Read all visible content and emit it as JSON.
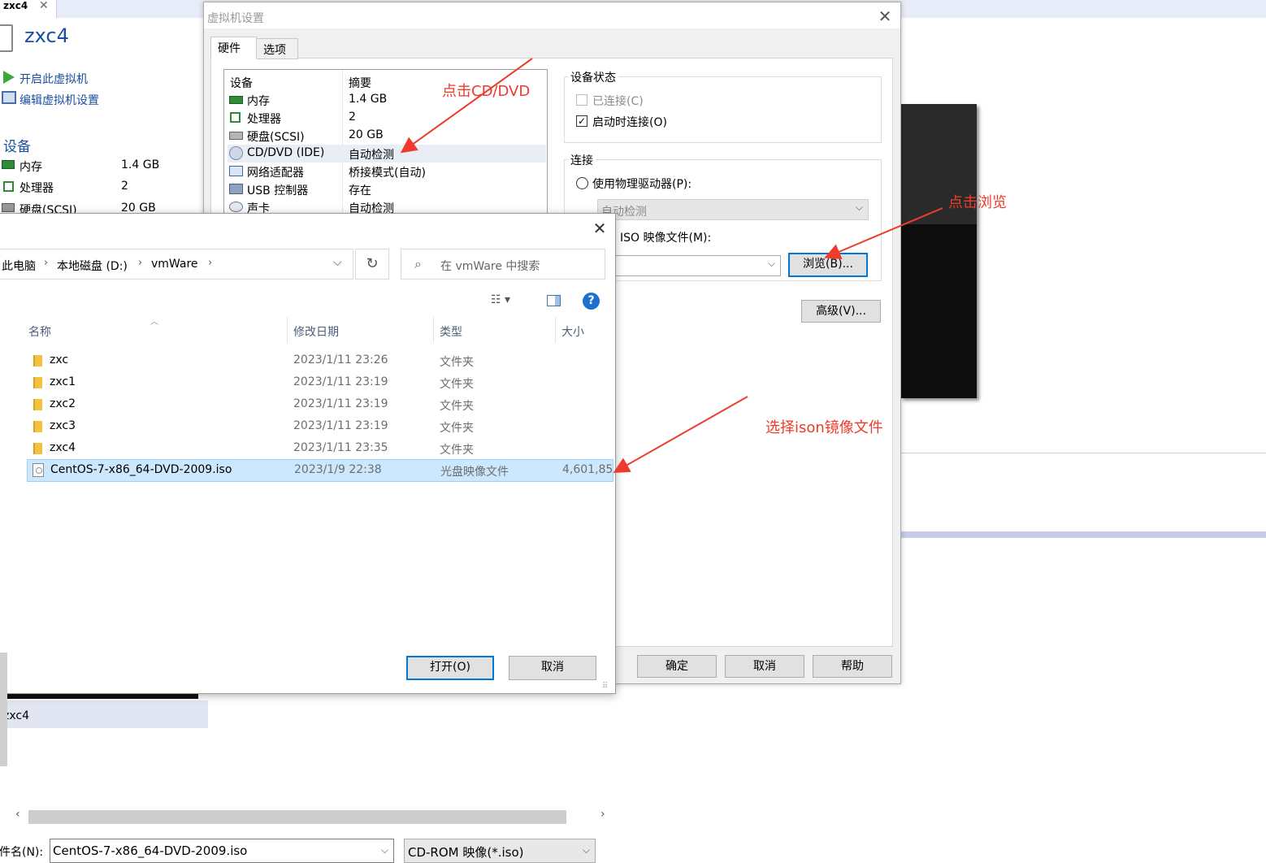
{
  "background": {
    "tab_label": "zxc4",
    "tab_close": "✕",
    "vm_name": "zxc4",
    "actions": [
      {
        "label": "开启此虚拟机"
      },
      {
        "label": "编辑虚拟机设置"
      }
    ],
    "devices_title": "设备",
    "devices": [
      {
        "name": "内存",
        "value": "1.4 GB"
      },
      {
        "name": "处理器",
        "value": "2"
      },
      {
        "name": "硬盘(SCSI)",
        "value": "20 GB"
      }
    ],
    "thumbnail_label": "zxc4"
  },
  "vm_settings": {
    "title": "虚拟机设置",
    "close": "✕",
    "tabs": [
      {
        "label": "硬件",
        "active": true
      },
      {
        "label": "选项",
        "active": false
      }
    ],
    "device_list": {
      "headers": [
        "设备",
        "摘要"
      ],
      "rows": [
        {
          "device": "内存",
          "summary": "1.4 GB",
          "icon": "memory-icon"
        },
        {
          "device": "处理器",
          "summary": "2",
          "icon": "cpu-icon"
        },
        {
          "device": "硬盘(SCSI)",
          "summary": "20 GB",
          "icon": "harddisk-icon"
        },
        {
          "device": "CD/DVD (IDE)",
          "summary": "自动检测",
          "icon": "cdrom-icon",
          "selected": true
        },
        {
          "device": "网络适配器",
          "summary": "桥接模式(自动)",
          "icon": "network-icon"
        },
        {
          "device": "USB 控制器",
          "summary": "存在",
          "icon": "usb-icon"
        },
        {
          "device": "声卡",
          "summary": "自动检测",
          "icon": "sound-icon"
        }
      ]
    },
    "device_status": {
      "title": "设备状态",
      "connected_label": "已连接(C)",
      "connected": false,
      "connect_at_power_on_label": "启动时连接(O)",
      "connect_at_power_on": true
    },
    "connection": {
      "title": "连接",
      "physical_drive_label": "使用物理驱动器(P):",
      "physical_drive_value": "自动检测",
      "iso_label": "ISO 映像文件(M):",
      "iso_value": "",
      "browse_button": "浏览(B)..."
    },
    "advanced_button": "高级(V)...",
    "footer_buttons": {
      "ok": "确定",
      "cancel": "取消",
      "help": "帮助"
    }
  },
  "file_dialog": {
    "close": "✕",
    "breadcrumb": [
      "此电脑",
      "本地磁盘 (D:)",
      "vmWare"
    ],
    "breadcrumb_sep": "›",
    "dropdown": "⌵",
    "refresh": "↻",
    "search_placeholder": "在 vmWare 中搜索",
    "search_icon": "⌕",
    "help": "?",
    "view_menu": "☷ ▾",
    "columns": {
      "name": "名称",
      "modified": "修改日期",
      "type": "类型",
      "size": "大小"
    },
    "files": [
      {
        "name": "zxc",
        "modified": "2023/1/11 23:26",
        "type": "文件夹",
        "size": "",
        "kind": "folder"
      },
      {
        "name": "zxc1",
        "modified": "2023/1/11 23:19",
        "type": "文件夹",
        "size": "",
        "kind": "folder"
      },
      {
        "name": "zxc2",
        "modified": "2023/1/11 23:19",
        "type": "文件夹",
        "size": "",
        "kind": "folder"
      },
      {
        "name": "zxc3",
        "modified": "2023/1/11 23:19",
        "type": "文件夹",
        "size": "",
        "kind": "folder"
      },
      {
        "name": "zxc4",
        "modified": "2023/1/11 23:35",
        "type": "文件夹",
        "size": "",
        "kind": "folder"
      },
      {
        "name": "CentOS-7-x86_64-DVD-2009.iso",
        "modified": "2023/1/9 22:38",
        "type": "光盘映像文件",
        "size": "4,601,85",
        "kind": "iso",
        "selected": true
      }
    ],
    "filename_label": "件名(N):",
    "filename_value": "CentOS-7-x86_64-DVD-2009.iso",
    "filetype_value": "CD-ROM 映像(*.iso)",
    "open_button": "打开(O)",
    "cancel_button": "取消"
  },
  "annotations": {
    "click_cd": "点击CD/DVD",
    "click_browse": "点击浏览",
    "select_iso": "选择ison镜像文件",
    "color": "#ee3b2b"
  }
}
